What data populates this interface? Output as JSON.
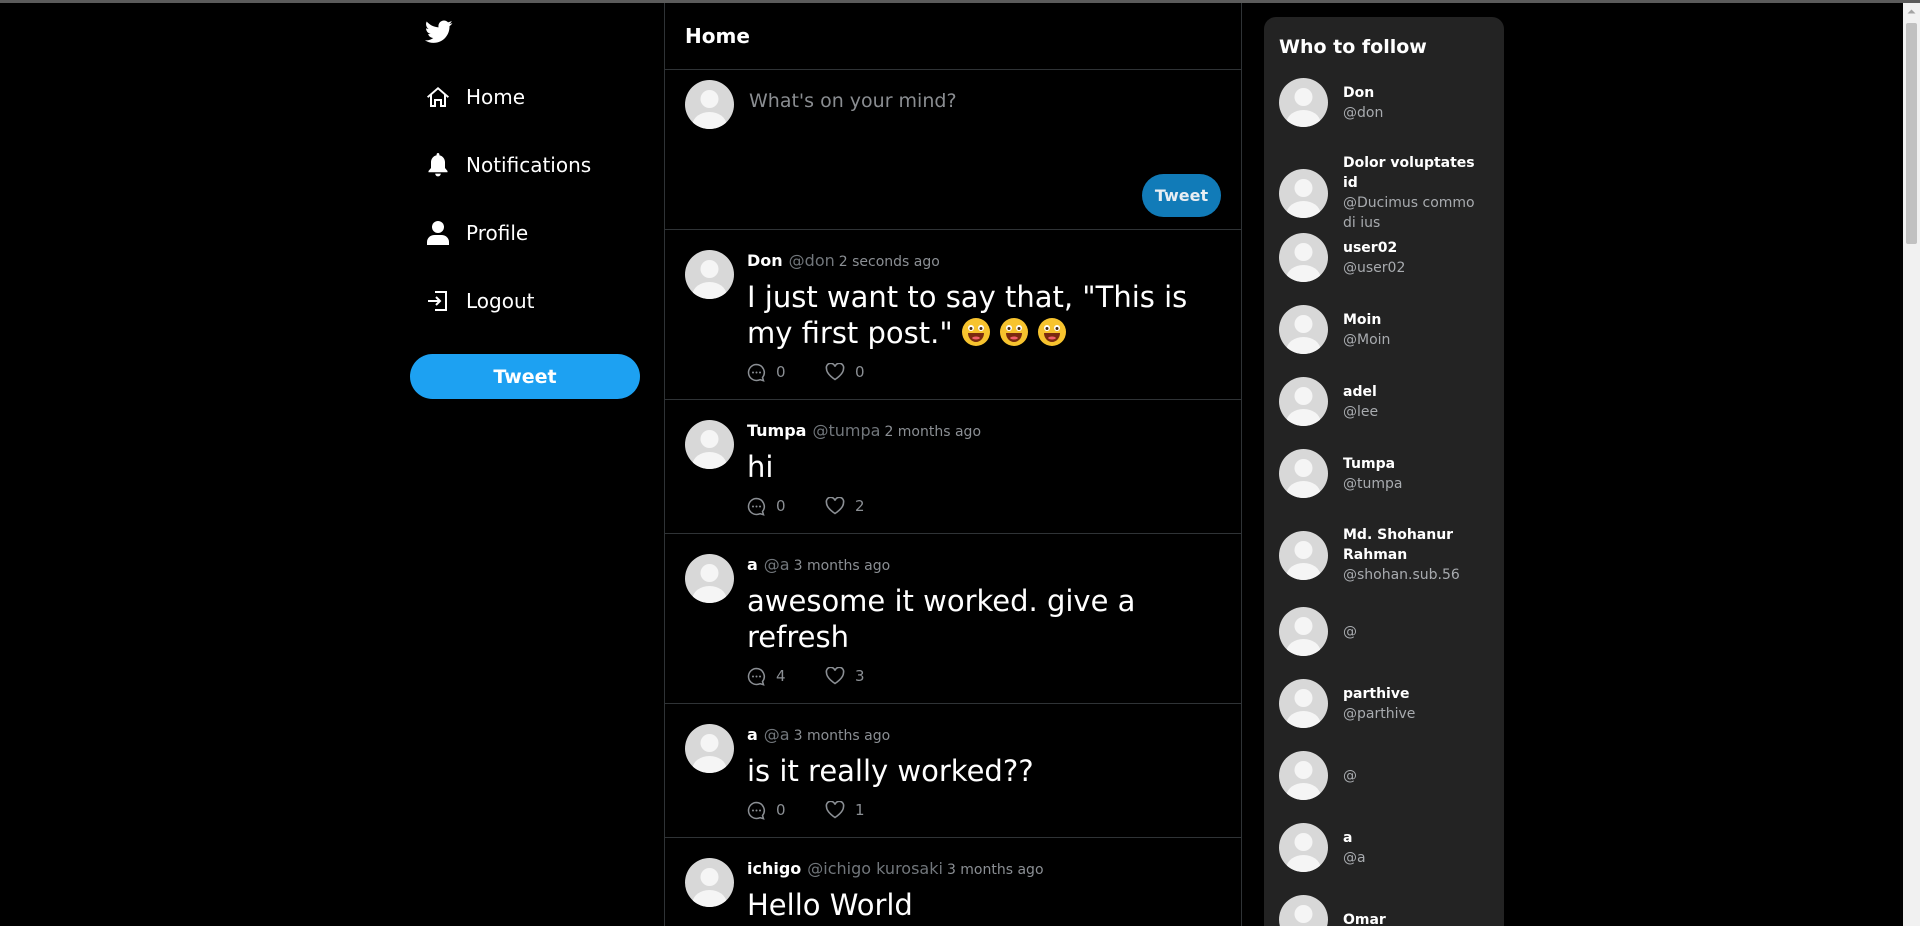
{
  "sidebar": {
    "nav": [
      {
        "label": "Home",
        "icon": "home-icon"
      },
      {
        "label": "Notifications",
        "icon": "bell-icon"
      },
      {
        "label": "Profile",
        "icon": "user-icon"
      },
      {
        "label": "Logout",
        "icon": "logout-icon"
      }
    ],
    "tweet_label": "Tweet"
  },
  "main": {
    "title": "Home",
    "composer": {
      "placeholder": "What's on your mind?",
      "button_label": "Tweet"
    },
    "posts": [
      {
        "name": "Don",
        "handle": "@don",
        "time": "2 seconds ago",
        "text": "I just want to say that, \"This is my first post.\"",
        "emoji": "grinning-face-emoji",
        "emoji_count": 3,
        "comments": "0",
        "likes": "0"
      },
      {
        "name": "Tumpa",
        "handle": "@tumpa",
        "time": "2 months ago",
        "text": "hi",
        "comments": "0",
        "likes": "2"
      },
      {
        "name": "a",
        "handle": "@a",
        "time": "3 months ago",
        "text": "awesome it worked. give a refresh",
        "comments": "4",
        "likes": "3"
      },
      {
        "name": "a",
        "handle": "@a",
        "time": "3 months ago",
        "text": "is it really worked??",
        "comments": "0",
        "likes": "1"
      },
      {
        "name": "ichigo",
        "handle": "@ichigo kurosaki",
        "time": "3 months ago",
        "text": "Hello World",
        "comments": "",
        "likes": ""
      }
    ]
  },
  "who_to_follow": {
    "title": "Who to follow",
    "users": [
      {
        "name": "Don",
        "handle": "@don"
      },
      {
        "name": "Dolor voluptates id",
        "handle": "@Ducimus commodi ius"
      },
      {
        "name": "user02",
        "handle": "@user02"
      },
      {
        "name": "Moin",
        "handle": "@Moin"
      },
      {
        "name": "adel",
        "handle": "@lee"
      },
      {
        "name": "Tumpa",
        "handle": "@tumpa"
      },
      {
        "name": "Md. Shohanur Rahman",
        "handle": "@shohan.sub.56"
      },
      {
        "name": "",
        "handle": "@"
      },
      {
        "name": "parthive",
        "handle": "@parthive"
      },
      {
        "name": "",
        "handle": "@"
      },
      {
        "name": "a",
        "handle": "@a"
      },
      {
        "name": "Omar",
        "handle": ""
      }
    ]
  },
  "colors": {
    "accent": "#1da1f2",
    "small_tweet_button": "#117bb8",
    "background": "#000000",
    "panel": "#232323",
    "muted_text": "#71767b"
  }
}
